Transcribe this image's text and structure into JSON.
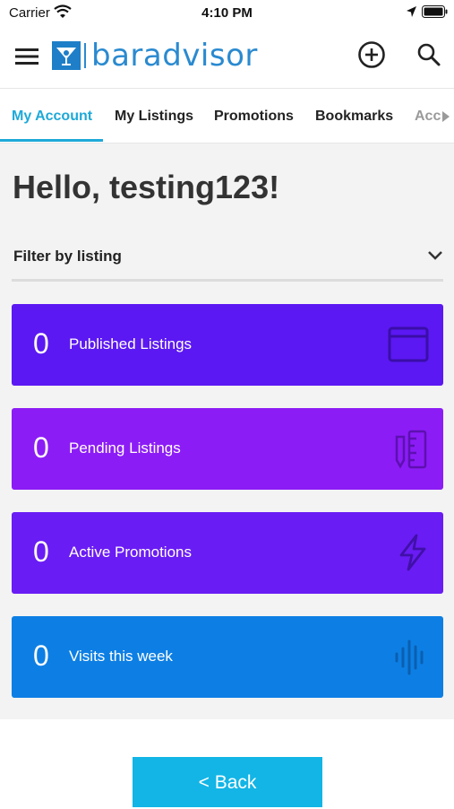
{
  "status_bar": {
    "carrier": "Carrier",
    "time": "4:10 PM"
  },
  "header": {
    "brand_name": "baradvisor",
    "icons": [
      "menu-icon",
      "add-circle-icon",
      "search-icon"
    ]
  },
  "tabs": [
    {
      "label": "My Account",
      "active": true
    },
    {
      "label": "My Listings",
      "active": false
    },
    {
      "label": "Promotions",
      "active": false
    },
    {
      "label": "Bookmarks",
      "active": false
    },
    {
      "label": "Acc",
      "active": false
    }
  ],
  "main": {
    "greeting": "Hello, testing123!",
    "filter_label": "Filter by listing",
    "stats": [
      {
        "value": "0",
        "label": "Published Listings",
        "color": "#5b18f2",
        "icon": "browser-window-icon"
      },
      {
        "value": "0",
        "label": "Pending Listings",
        "color": "#8c1cf6",
        "icon": "pencil-ruler-icon"
      },
      {
        "value": "0",
        "label": "Active Promotions",
        "color": "#6a1cf4",
        "icon": "lightning-icon"
      },
      {
        "value": "0",
        "label": "Visits this week",
        "color": "#0d7fe4",
        "icon": "sound-wave-icon"
      }
    ]
  },
  "footer": {
    "back_label": "< Back"
  },
  "colors": {
    "accent": "#1ea9d8",
    "brand": "#2a8ad0",
    "back_button": "#12b5e6"
  }
}
